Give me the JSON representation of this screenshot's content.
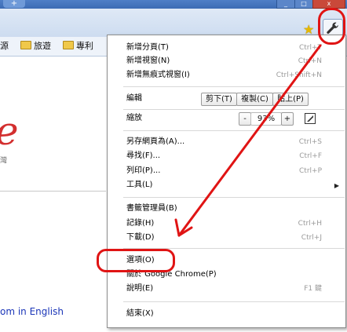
{
  "window": {
    "newtab_label": "+",
    "min_label": "_",
    "max_label": "□",
    "close_label": "x"
  },
  "toolbar": {
    "star_icon": "star-icon",
    "wrench_icon": "wrench-icon"
  },
  "bookmarks": [
    {
      "label": "源"
    },
    {
      "label": "旅遊"
    },
    {
      "label": "專利"
    }
  ],
  "page": {
    "logo_letter": "e",
    "logo_sub": "灣",
    "english_link": "om in English"
  },
  "menu": {
    "new_tab": {
      "label": "新增分頁(T)",
      "shortcut": "Ctrl+T"
    },
    "new_window": {
      "label": "新增視窗(N)",
      "shortcut": "Ctrl+N"
    },
    "incognito": {
      "label": "新增無痕式視窗(I)",
      "shortcut": "Ctrl+Shift+N"
    },
    "edit": {
      "label": "編輯",
      "cut": "剪下(T)",
      "copy": "複製(C)",
      "paste": "貼上(P)"
    },
    "zoom": {
      "label": "縮放",
      "minus": "-",
      "value": "93%",
      "plus": "+"
    },
    "save_as": {
      "label": "另存網頁為(A)...",
      "shortcut": "Ctrl+S"
    },
    "find": {
      "label": "尋找(F)...",
      "shortcut": "Ctrl+F"
    },
    "print": {
      "label": "列印(P)...",
      "shortcut": "Ctrl+P"
    },
    "tools": {
      "label": "工具(L)",
      "arrow": "▶"
    },
    "bookmark_manager": {
      "label": "書籤管理員(B)"
    },
    "history": {
      "label": "記錄(H)",
      "shortcut": "Ctrl+H"
    },
    "downloads": {
      "label": "下載(D)",
      "shortcut": "Ctrl+J"
    },
    "options": {
      "label": "選項(O)"
    },
    "about": {
      "label": "關於 Google Chrome(P)"
    },
    "help": {
      "label": "說明(E)",
      "shortcut": "F1 鍵"
    },
    "exit": {
      "label": "結束(X)"
    }
  },
  "colors": {
    "annotation": "#e01414"
  }
}
